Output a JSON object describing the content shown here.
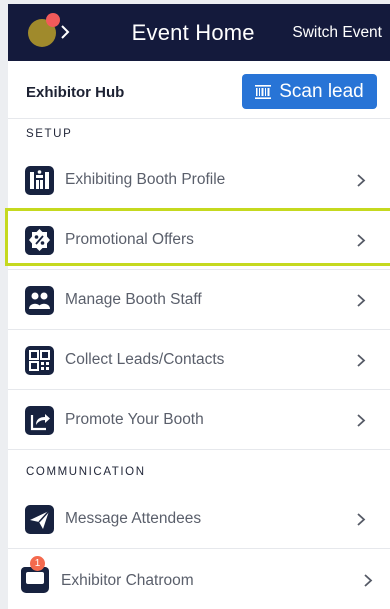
{
  "header": {
    "title": "Event Home",
    "switch_label": "Switch Event"
  },
  "hub": {
    "title": "Exhibitor Hub",
    "scan_label": "Scan lead"
  },
  "sections": {
    "setup": "SETUP",
    "communication": "COMMUNICATION"
  },
  "menu": {
    "booth_profile": "Exhibiting Booth Profile",
    "promotional_offers": "Promotional Offers",
    "booth_staff": "Manage Booth Staff",
    "collect_leads": "Collect Leads/Contacts",
    "promote_booth": "Promote Your Booth",
    "message_attendees": "Message Attendees",
    "chatroom": "Exhibitor Chatroom",
    "chatroom_badge": "1"
  },
  "colors": {
    "header_bg": "#141a3c",
    "accent_blue": "#2874d6",
    "highlight": "#c5d91f",
    "icon_bg": "#17223f",
    "badge": "#f46a4e"
  },
  "icons": {
    "booth_profile": "booth-icon",
    "promotional_offers": "discount-badge-icon",
    "booth_staff": "staff-group-icon",
    "collect_leads": "qr-code-icon",
    "promote_booth": "share-arrow-icon",
    "message_attendees": "paper-plane-icon",
    "chatroom": "chat-bubble-icon",
    "scan": "barcode-icon",
    "row_chevron": "chevron-right-icon"
  }
}
